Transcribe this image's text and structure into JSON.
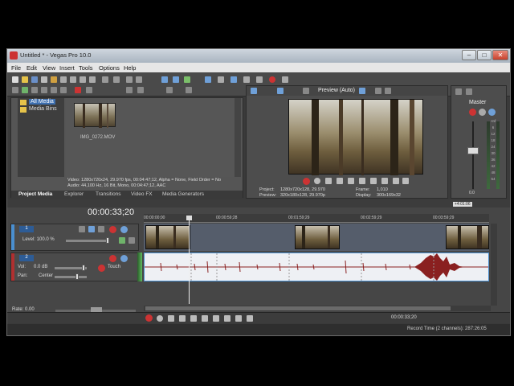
{
  "window": {
    "title": "Untitled * - Vegas Pro 10.0",
    "min": "–",
    "max": "□",
    "close": "✕"
  },
  "menu": [
    "File",
    "Edit",
    "View",
    "Insert",
    "Tools",
    "Options",
    "Help"
  ],
  "explorer": {
    "tree": [
      "All Media",
      "Media Bins"
    ],
    "file_name": "IMG_0272.MOV",
    "info_line1": "Video: 1280x720x24, 29.970 fps, 00:04:47;12, Alpha = None, Field Order = No",
    "info_line2": "Audio: 44,100 Hz, 16 Bit, Mono, 00:04:47;12, AAC",
    "tabs": [
      "Project Media",
      "Explorer",
      "Transitions",
      "Video FX",
      "Media Generators"
    ]
  },
  "preview": {
    "mode": "Preview (Auto)",
    "project_label": "Project:",
    "project_value": "1280x720x128, 29.970",
    "preview_label": "Preview:",
    "preview_value": "320x180x128, 29.970p",
    "frame_label": "Frame:",
    "frame_value": "1,010",
    "display_label": "Display:",
    "display_value": "300x169x32"
  },
  "master": {
    "label": "Master",
    "scale": [
      "-Inf",
      "-Inf",
      "6",
      "12",
      "18",
      "24",
      "30",
      "36",
      "42",
      "48",
      "54"
    ],
    "readout": "0.0"
  },
  "timeline": {
    "timecode": "00:00:33;20",
    "marker": "+4:01:06",
    "ruler": [
      "00:00:00;00",
      "00:00:59;28",
      "00:01:59;29",
      "00:02:59;29",
      "00:03:59;29"
    ],
    "video_track": {
      "number": "1",
      "level": "Level: 100.0 %"
    },
    "audio_track": {
      "number": "2",
      "vol": "Vol:",
      "vol_value": "0.0 dB",
      "pan": "Pan:",
      "pan_value": "Center",
      "touch": "Touch"
    },
    "rate": "Rate: 0.00",
    "status_time": "00:00:33;20",
    "record_time": "Record Time (2 channels): 287:26:05"
  },
  "colors": {
    "accent": "#4a8fd0",
    "waveform": "#8a2020",
    "audio_bg": "#eef0f4"
  }
}
